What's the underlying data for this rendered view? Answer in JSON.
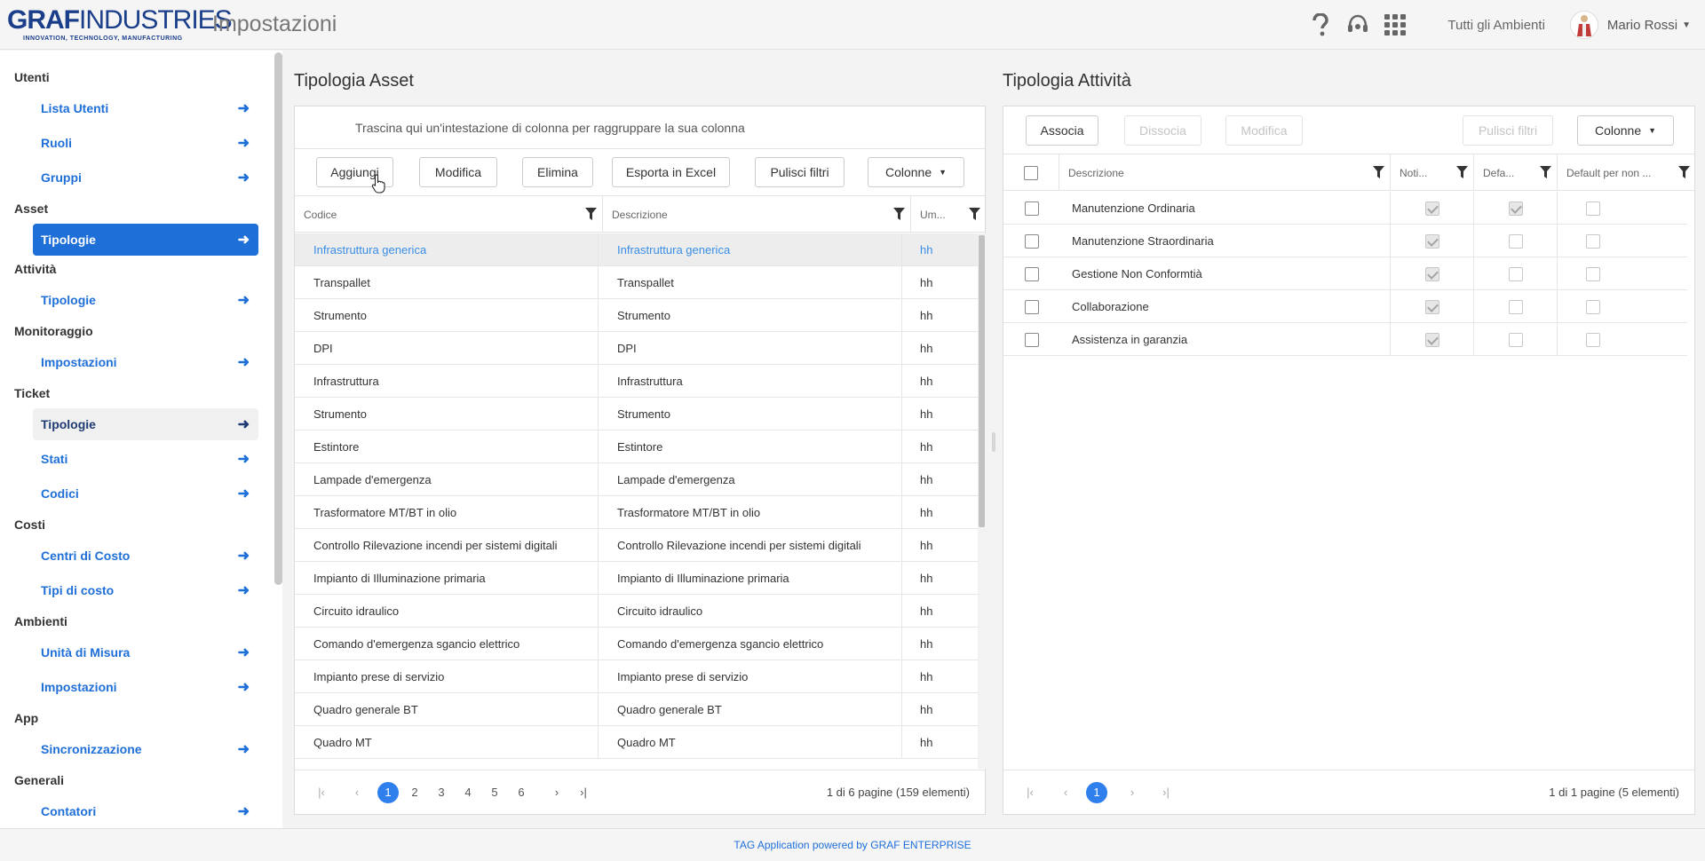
{
  "header": {
    "logo_main_bold": "GRAF",
    "logo_main_thin": "INDUSTRIES",
    "logo_tagline": "INNOVATION, TECHNOLOGY, MANUFACTURING",
    "page_title": "Impostazioni",
    "icons": [
      "help-icon",
      "headset-icon",
      "apps-grid-icon"
    ],
    "environment": "Tutti gli Ambienti",
    "user_name": "Mario Rossi"
  },
  "sidebar": {
    "groups": [
      {
        "label": "Utenti",
        "items": [
          {
            "label": "Lista Utenti"
          },
          {
            "label": "Ruoli"
          },
          {
            "label": "Gruppi"
          }
        ]
      },
      {
        "label": "Asset",
        "items": [
          {
            "label": "Tipologie",
            "state": "active"
          }
        ]
      },
      {
        "label": "Attività",
        "items": [
          {
            "label": "Tipologie"
          }
        ]
      },
      {
        "label": "Monitoraggio",
        "items": [
          {
            "label": "Impostazioni"
          }
        ]
      },
      {
        "label": "Ticket",
        "items": [
          {
            "label": "Tipologie",
            "state": "hover"
          },
          {
            "label": "Stati"
          },
          {
            "label": "Codici"
          }
        ]
      },
      {
        "label": "Costi",
        "items": [
          {
            "label": "Centri di Costo"
          },
          {
            "label": "Tipi di costo"
          }
        ]
      },
      {
        "label": "Ambienti",
        "items": [
          {
            "label": "Unità di Misura"
          },
          {
            "label": "Impostazioni"
          }
        ]
      },
      {
        "label": "App",
        "items": [
          {
            "label": "Sincronizzazione"
          }
        ]
      },
      {
        "label": "Generali",
        "items": [
          {
            "label": "Contatori"
          }
        ]
      }
    ]
  },
  "asset_panel": {
    "title": "Tipologia Asset",
    "group_hint": "Trascina qui un'intestazione di colonna per raggruppare la sua colonna",
    "buttons": {
      "add": "Aggiungi",
      "edit": "Modifica",
      "delete": "Elimina",
      "export": "Esporta in Excel",
      "clear_filters": "Pulisci filtri",
      "columns": "Colonne"
    },
    "columns": [
      "Codice",
      "Descrizione",
      "Um..."
    ],
    "rows": [
      {
        "codice": "Infrastruttura generica",
        "descrizione": "Infrastruttura generica",
        "um": "hh",
        "selected": true
      },
      {
        "codice": "Transpallet",
        "descrizione": "Transpallet",
        "um": "hh"
      },
      {
        "codice": "Strumento",
        "descrizione": "Strumento",
        "um": "hh"
      },
      {
        "codice": "DPI",
        "descrizione": "DPI",
        "um": "hh"
      },
      {
        "codice": "Infrastruttura",
        "descrizione": "Infrastruttura",
        "um": "hh"
      },
      {
        "codice": "Strumento",
        "descrizione": "Strumento",
        "um": "hh"
      },
      {
        "codice": "Estintore",
        "descrizione": "Estintore",
        "um": "hh"
      },
      {
        "codice": "Lampade d'emergenza",
        "descrizione": "Lampade d'emergenza",
        "um": "hh"
      },
      {
        "codice": "Trasformatore MT/BT in olio",
        "descrizione": "Trasformatore MT/BT in olio",
        "um": "hh"
      },
      {
        "codice": "Controllo Rilevazione incendi per sistemi digitali",
        "descrizione": "Controllo Rilevazione incendi per sistemi digitali",
        "um": "hh"
      },
      {
        "codice": "Impianto di Illuminazione primaria",
        "descrizione": "Impianto di Illuminazione primaria",
        "um": "hh"
      },
      {
        "codice": "Circuito idraulico",
        "descrizione": "Circuito idraulico",
        "um": "hh"
      },
      {
        "codice": "Comando d'emergenza sgancio elettrico",
        "descrizione": "Comando d'emergenza sgancio elettrico",
        "um": "hh"
      },
      {
        "codice": "Impianto prese di servizio",
        "descrizione": "Impianto prese di servizio",
        "um": "hh"
      },
      {
        "codice": "Quadro generale BT",
        "descrizione": "Quadro generale BT",
        "um": "hh"
      },
      {
        "codice": "Quadro MT",
        "descrizione": "Quadro MT",
        "um": "hh"
      }
    ],
    "pager": {
      "pages": [
        "1",
        "2",
        "3",
        "4",
        "5",
        "6"
      ],
      "current": "1",
      "info": "1 di 6 pagine (159 elementi)"
    }
  },
  "activity_panel": {
    "title": "Tipologia Attività",
    "buttons": {
      "associate": "Associa",
      "dissociate": "Dissocia",
      "edit": "Modifica",
      "clear_filters": "Pulisci filtri",
      "columns": "Colonne"
    },
    "columns": [
      "Descrizione",
      "Noti...",
      "Defa...",
      "Default per non ..."
    ],
    "rows": [
      {
        "descrizione": "Manutenzione Ordinaria",
        "noti": true,
        "defa": true,
        "default_non": false
      },
      {
        "descrizione": "Manutenzione Straordinaria",
        "noti": true,
        "defa": false,
        "default_non": false
      },
      {
        "descrizione": "Gestione Non Conformtià",
        "noti": true,
        "defa": false,
        "default_non": false
      },
      {
        "descrizione": "Collaborazione",
        "noti": true,
        "defa": false,
        "default_non": false
      },
      {
        "descrizione": "Assistenza in garanzia",
        "noti": true,
        "defa": false,
        "default_non": false
      }
    ],
    "pager": {
      "pages": [
        "1"
      ],
      "current": "1",
      "info": "1 di 1 pagine (5 elementi)"
    }
  },
  "footer": {
    "text": "TAG Application powered by GRAF ENTERPRISE"
  },
  "colors": {
    "accent": "#1f6fd8",
    "pager_current": "#2f80ed",
    "selected_text": "#3a8ee6"
  }
}
